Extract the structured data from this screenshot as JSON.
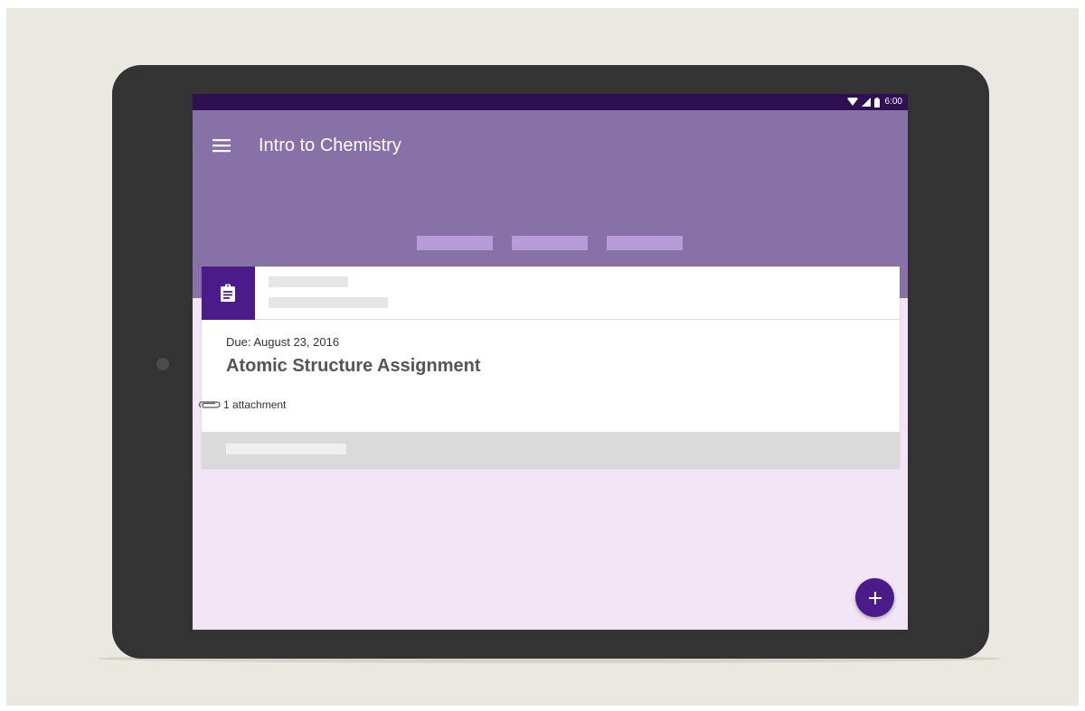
{
  "status_bar": {
    "time": "6:00",
    "icons": [
      "wifi-icon",
      "signal-icon",
      "battery-icon"
    ]
  },
  "app_bar": {
    "title": "Intro to Chemistry",
    "menu_icon": "hamburger-menu-icon"
  },
  "card": {
    "icon": "assignment-clipboard-icon",
    "due": "Due: August 23, 2016",
    "title": "Atomic Structure Assignment",
    "attachment_icon": "paperclip-icon",
    "attachments": "1 attachment"
  },
  "fab": {
    "icon": "plus-icon"
  },
  "colors": {
    "status_bar": "#2e0f52",
    "app_bar": "#8871a7",
    "accent": "#4a1b89",
    "tab_placeholder": "#b79cd9",
    "screen_background": "#f2e5f6",
    "tablet_body": "#333333",
    "page_background": "#ebe8e0"
  }
}
